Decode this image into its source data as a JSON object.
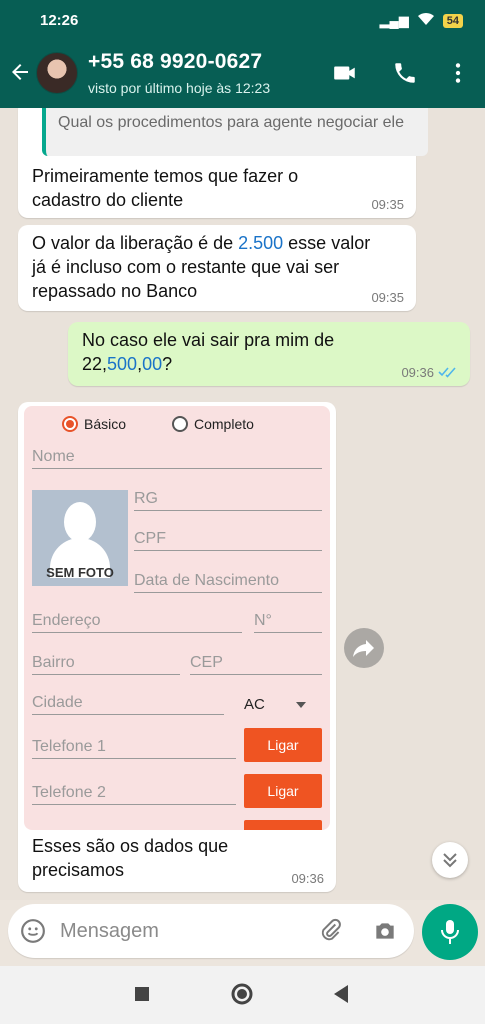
{
  "status_bar": {
    "time": "12:26",
    "battery": "54"
  },
  "header": {
    "contact": "+55 68 9920-0627",
    "status": "visto por último hoje às 12:23"
  },
  "messages": [
    {
      "quote": "Qual os procedimentos para agente negociar ele",
      "text": "Primeiramente temos que fazer o cadastro do cliente",
      "time": "09:35"
    },
    {
      "text_line1_a": "O valor da liberação é de ",
      "text_line1_num": "2.500",
      "text_line1_b": " esse valor",
      "text_line2": "já é incluso com o restante que vai ser",
      "text_line3": "repassado no Banco",
      "time": "09:35"
    },
    {
      "text_line1": "No caso ele vai sair pra mim de",
      "text_line2_a": "22,",
      "text_line2_b": "500",
      "text_line2_c": ",",
      "text_line2_d": "00",
      "text_line2_e": "?",
      "time": "09:36"
    },
    {
      "caption_line1": "Esses são os dados que",
      "caption_line2": "precisamos",
      "time": "09:36"
    }
  ],
  "form": {
    "radio_basic": "Básico",
    "radio_complete": "Completo",
    "nome": "Nome",
    "rg": "RG",
    "cpf": "CPF",
    "nascimento": "Data de Nascimento",
    "photo_label": "SEM FOTO",
    "endereco": "Endereço",
    "numero": "N°",
    "bairro": "Bairro",
    "cep": "CEP",
    "cidade": "Cidade",
    "uf": "AC",
    "telefone1": "Telefone 1",
    "telefone2": "Telefone 2",
    "ligar": "Ligar",
    "accent": "#ef5422"
  },
  "input": {
    "placeholder": "Mensagem"
  },
  "colors": {
    "header": "#075e54",
    "outgoing": "#dcf8c6",
    "mic": "#00a884",
    "link": "#1a73c8"
  },
  "icons": [
    "back-arrow-icon",
    "video-call-icon",
    "phone-icon",
    "more-vert-icon",
    "emoji-icon",
    "attach-icon",
    "camera-icon",
    "mic-icon",
    "share-icon",
    "scroll-down-icon",
    "nav-square-icon",
    "nav-home-icon",
    "nav-back-icon"
  ]
}
